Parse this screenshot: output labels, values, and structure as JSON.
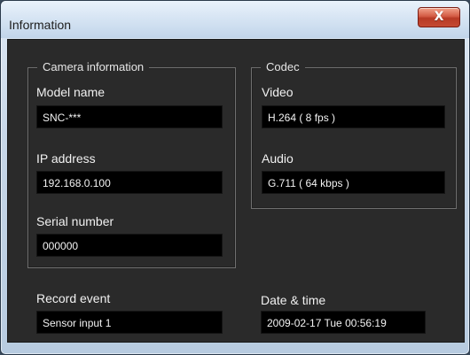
{
  "window": {
    "title": "Information",
    "close_glyph": "X"
  },
  "camera_information": {
    "legend": "Camera information",
    "model_name": {
      "label": "Model name",
      "value": "SNC-***"
    },
    "ip_address": {
      "label": "IP address",
      "value": "192.168.0.100"
    },
    "serial_number": {
      "label": "Serial number",
      "value": "000000"
    }
  },
  "codec": {
    "legend": "Codec",
    "video": {
      "label": "Video",
      "value": "H.264 ( 8 fps )"
    },
    "audio": {
      "label": "Audio",
      "value": "G.711 ( 64 kbps )"
    }
  },
  "record_event": {
    "label": "Record event",
    "value": "Sensor input 1"
  },
  "date_time": {
    "label": "Date & time",
    "value": "2009-02-17 Tue 00:56:19"
  }
}
